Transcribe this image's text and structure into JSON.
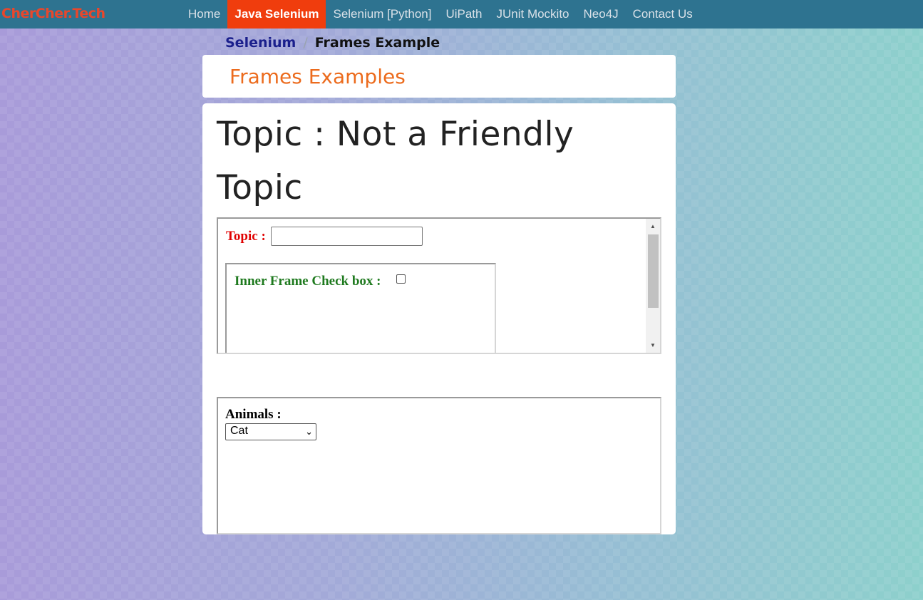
{
  "brand": "CherCher.Tech",
  "nav": {
    "items": [
      {
        "label": "Home"
      },
      {
        "label": "Java Selenium",
        "active": true
      },
      {
        "label": "Selenium [Python]"
      },
      {
        "label": "UiPath"
      },
      {
        "label": "JUnit Mockito"
      },
      {
        "label": "Neo4J"
      },
      {
        "label": "Contact Us"
      }
    ]
  },
  "breadcrumb": {
    "parent": "Selenium",
    "separator": "/",
    "current": "Frames Example"
  },
  "page_title": "Frames Examples",
  "topic_heading": "Topic : Not a Friendly Topic",
  "frame1": {
    "topic_label": "Topic :",
    "topic_value": "",
    "inner_frame": {
      "checkbox_label": "Inner Frame Check box :",
      "checked": false
    },
    "scrollbar": {
      "up_icon": "triangle-up",
      "down_icon": "triangle-down"
    }
  },
  "frame2": {
    "animals_label": "Animals :",
    "selected_animal": "Cat"
  },
  "colors": {
    "navbar": "#2e7390",
    "brand": "#e8472c",
    "active_nav": "#f03d0d",
    "page_title": "#ec6b1d",
    "topic_label": "#e00000",
    "inner_label": "#1f7a1f"
  }
}
